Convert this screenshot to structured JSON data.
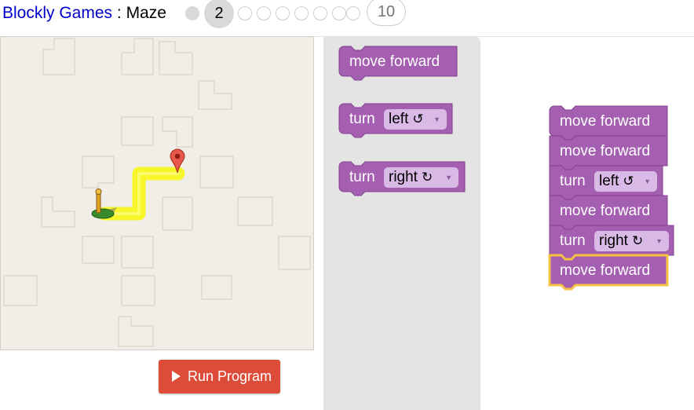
{
  "header": {
    "app_name": "Blockly Games",
    "separator": " : ",
    "game_name": "Maze",
    "levels": [
      {
        "label": "",
        "state": "done"
      },
      {
        "label": "2",
        "state": "current"
      },
      {
        "label": "",
        "state": "empty"
      },
      {
        "label": "",
        "state": "empty"
      },
      {
        "label": "",
        "state": "empty"
      },
      {
        "label": "",
        "state": "empty"
      },
      {
        "label": "",
        "state": "empty"
      },
      {
        "label": "",
        "state": "empty"
      },
      {
        "label": "",
        "state": "empty"
      },
      {
        "label": "10",
        "state": "last"
      }
    ]
  },
  "run_button": {
    "label": "Run Program"
  },
  "toolbox": {
    "blocks": [
      {
        "type": "move",
        "text": "move forward"
      },
      {
        "type": "turn",
        "text": "turn",
        "dropdown": "left",
        "symbol": "↺"
      },
      {
        "type": "turn",
        "text": "turn",
        "dropdown": "right",
        "symbol": "↻"
      }
    ]
  },
  "workspace": {
    "program": [
      {
        "type": "move",
        "text": "move forward",
        "highlighted": false
      },
      {
        "type": "move",
        "text": "move forward",
        "highlighted": false
      },
      {
        "type": "turn",
        "text": "turn",
        "dropdown": "left",
        "symbol": "↺",
        "highlighted": false
      },
      {
        "type": "move",
        "text": "move forward",
        "highlighted": false
      },
      {
        "type": "turn",
        "text": "turn",
        "dropdown": "right",
        "symbol": "↻",
        "highlighted": false
      },
      {
        "type": "move",
        "text": "move forward",
        "highlighted": true
      }
    ]
  },
  "colors": {
    "block": "#a55fb0",
    "block_dark": "#84428f",
    "highlight": "#f5c242",
    "path": "#f6f62a",
    "run_button": "#dd4b39",
    "maze_bg": "#f1eee7",
    "toolbox_bg": "#e4e4e4"
  }
}
